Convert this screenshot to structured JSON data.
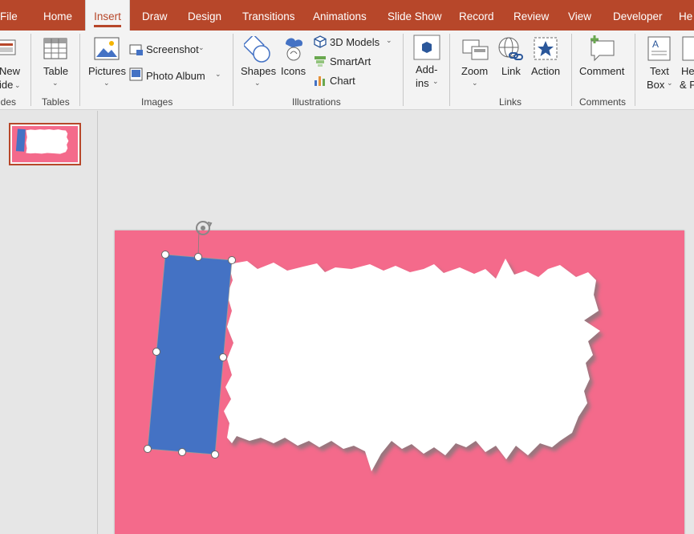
{
  "tabs": [
    {
      "label": "File"
    },
    {
      "label": "Home"
    },
    {
      "label": "Insert"
    },
    {
      "label": "Draw"
    },
    {
      "label": "Design"
    },
    {
      "label": "Transitions"
    },
    {
      "label": "Animations"
    },
    {
      "label": "Slide Show"
    },
    {
      "label": "Record"
    },
    {
      "label": "Review"
    },
    {
      "label": "View"
    },
    {
      "label": "Developer"
    },
    {
      "label": "He"
    }
  ],
  "active_tab": "Insert",
  "ribbon": {
    "slides": {
      "new_slide_line1": "New",
      "new_slide_line2": "ide",
      "group_label": "ides"
    },
    "tables": {
      "table": "Table",
      "group_label": "Tables"
    },
    "images": {
      "pictures": "Pictures",
      "screenshot": "Screenshot",
      "photo_album": "Photo Album",
      "group_label": "Images"
    },
    "illustrations": {
      "shapes": "Shapes",
      "icons": "Icons",
      "models_3d": "3D Models",
      "smartart": "SmartArt",
      "chart": "Chart",
      "group_label": "Illustrations"
    },
    "addins": {
      "line1": "Add-",
      "line2": "ins"
    },
    "links": {
      "zoom": "Zoom",
      "link": "Link",
      "action": "Action",
      "group_label": "Links"
    },
    "comments": {
      "comment": "Comment",
      "group_label": "Comments"
    },
    "text": {
      "textbox_line1": "Text",
      "textbox_line2": "Box",
      "header_line1": "He",
      "header_line2": "& F"
    }
  },
  "colors": {
    "accent": "#b7472a",
    "slide_bg": "#f46a8b",
    "rect_fill": "#4472c4"
  },
  "icons": [
    "new-slide-icon",
    "table-icon",
    "pictures-icon",
    "screenshot-icon",
    "photo-album-icon",
    "shapes-icon",
    "icons-icon",
    "3d-models-icon",
    "smartart-icon",
    "chart-icon",
    "addins-icon",
    "zoom-icon",
    "link-icon",
    "action-icon",
    "comment-icon",
    "textbox-icon",
    "rotate-handle-icon"
  ]
}
